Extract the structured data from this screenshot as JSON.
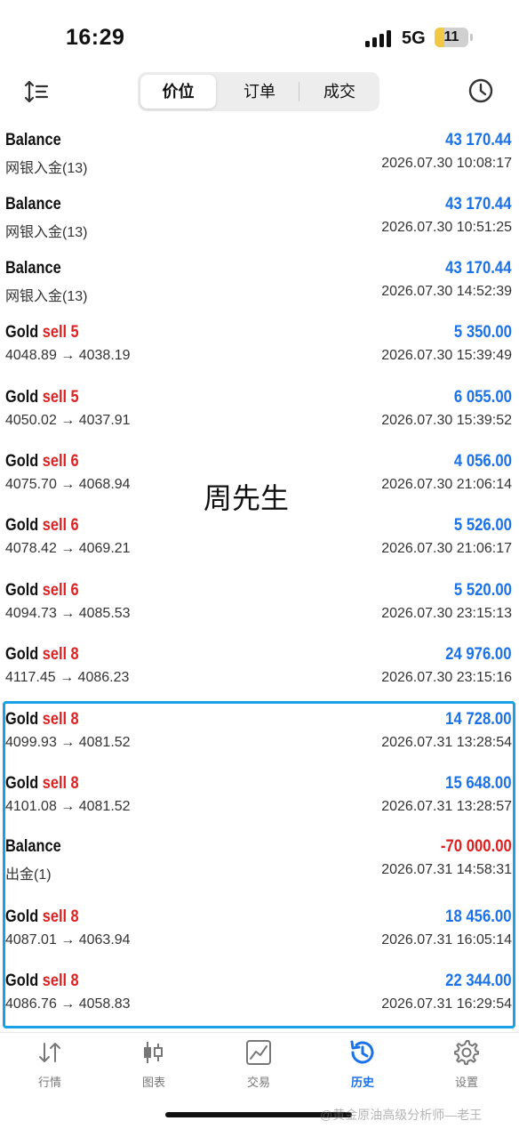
{
  "status": {
    "time": "16:29",
    "network": "5G",
    "battery": "11"
  },
  "tabs": [
    {
      "label": "价位",
      "active": true
    },
    {
      "label": "订单",
      "active": false
    },
    {
      "label": "成交",
      "active": false
    }
  ],
  "rows": [
    {
      "name": "Balance",
      "action": "",
      "amount": "43 170.44",
      "sub": "网银入金(13)",
      "date": "2026.07.30 10:08:17",
      "negative": false
    },
    {
      "name": "Balance",
      "action": "",
      "amount": "43 170.44",
      "sub": "网银入金(13)",
      "date": "2026.07.30 10:51:25",
      "negative": false
    },
    {
      "name": "Balance",
      "action": "",
      "amount": "43 170.44",
      "sub": "网银入金(13)",
      "date": "2026.07.30 14:52:39",
      "negative": false
    },
    {
      "name": "Gold",
      "action": "sell 5",
      "amount": "5 350.00",
      "sub": "4048.89 → 4038.19",
      "date": "2026.07.30 15:39:49",
      "negative": false
    },
    {
      "name": "Gold",
      "action": "sell 5",
      "amount": "6 055.00",
      "sub": "4050.02 → 4037.91",
      "date": "2026.07.30 15:39:52",
      "negative": false
    },
    {
      "name": "Gold",
      "action": "sell 6",
      "amount": "4 056.00",
      "sub": "4075.70 → 4068.94",
      "date": "2026.07.30 21:06:14",
      "negative": false
    },
    {
      "name": "Gold",
      "action": "sell 6",
      "amount": "5 526.00",
      "sub": "4078.42 → 4069.21",
      "date": "2026.07.30 21:06:17",
      "negative": false
    },
    {
      "name": "Gold",
      "action": "sell 6",
      "amount": "5 520.00",
      "sub": "4094.73 → 4085.53",
      "date": "2026.07.30 23:15:13",
      "negative": false
    },
    {
      "name": "Gold",
      "action": "sell 8",
      "amount": "24 976.00",
      "sub": "4117.45 → 4086.23",
      "date": "2026.07.30 23:15:16",
      "negative": false
    },
    {
      "name": "Gold",
      "action": "sell 8",
      "amount": "14 728.00",
      "sub": "4099.93 → 4081.52",
      "date": "2026.07.31 13:28:54",
      "negative": false
    },
    {
      "name": "Gold",
      "action": "sell 8",
      "amount": "15 648.00",
      "sub": "4101.08 → 4081.52",
      "date": "2026.07.31 13:28:57",
      "negative": false
    },
    {
      "name": "Balance",
      "action": "",
      "amount": "-70 000.00",
      "sub": "出金(1)",
      "date": "2026.07.31 14:58:31",
      "negative": true
    },
    {
      "name": "Gold",
      "action": "sell 8",
      "amount": "18 456.00",
      "sub": "4087.01 → 4063.94",
      "date": "2026.07.31 16:05:14",
      "negative": false
    },
    {
      "name": "Gold",
      "action": "sell 8",
      "amount": "22 344.00",
      "sub": "4086.76 → 4058.83",
      "date": "2026.07.31 16:29:54",
      "negative": false
    }
  ],
  "overlay_text": "周先生",
  "watermark": "@黄金原油高级分析师—老王",
  "nav": [
    {
      "label": "行情",
      "icon": "quotes-icon",
      "active": false
    },
    {
      "label": "图表",
      "icon": "chart-icon",
      "active": false
    },
    {
      "label": "交易",
      "icon": "trade-icon",
      "active": false
    },
    {
      "label": "历史",
      "icon": "history-icon",
      "active": true
    },
    {
      "label": "设置",
      "icon": "gear-icon",
      "active": false
    }
  ],
  "colors": {
    "accent": "#1b72e8",
    "sell": "#e02020",
    "highlight_border": "#1aa0e6"
  }
}
